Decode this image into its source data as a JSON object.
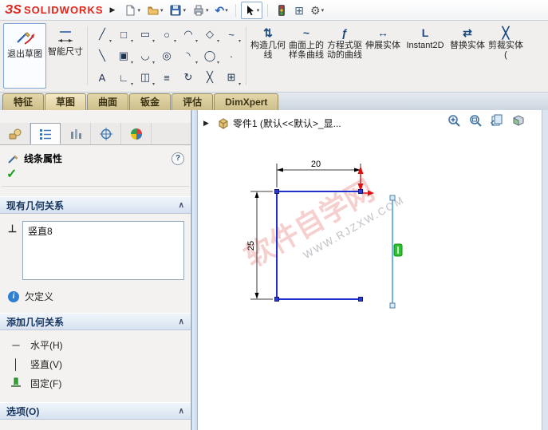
{
  "titlebar": {
    "logo_mark": "ЗS",
    "logo_text": "SOLIDWORKS"
  },
  "ribbon": {
    "exit_sketch_label": "退出草图",
    "smart_dimension_label": "智能尺寸",
    "sketch_tools": [
      {
        "name": "line",
        "glyph": "╱"
      },
      {
        "name": "corner-rectangle",
        "glyph": "□"
      },
      {
        "name": "straight-slot",
        "glyph": "▭"
      },
      {
        "name": "circle",
        "glyph": "○"
      },
      {
        "name": "centerpoint-arc",
        "glyph": "◠"
      },
      {
        "name": "polygon",
        "glyph": "◇"
      },
      {
        "name": "spline",
        "glyph": "~"
      },
      {
        "name": "centerline",
        "glyph": "╲"
      },
      {
        "name": "center-rectangle",
        "glyph": "▣"
      },
      {
        "name": "arc-slot",
        "glyph": "◡"
      },
      {
        "name": "perimeter-circle",
        "glyph": "◎"
      },
      {
        "name": "tangent-arc",
        "glyph": "◝"
      },
      {
        "name": "ellipse",
        "glyph": "◯"
      },
      {
        "name": "point",
        "glyph": "·"
      },
      {
        "name": "text",
        "glyph": "A"
      },
      {
        "name": "sketch-fillet",
        "glyph": "∟"
      },
      {
        "name": "mirror-entities",
        "glyph": "◫"
      },
      {
        "name": "offset-entities",
        "glyph": "≡"
      },
      {
        "name": "convert-entities",
        "glyph": "↻"
      },
      {
        "name": "trim-entities",
        "glyph": "╳"
      },
      {
        "name": "linear-sketch-pattern",
        "glyph": "⊞"
      }
    ],
    "right_tools": [
      {
        "name": "construction-geometry",
        "glyph": "⇅",
        "label": "构造几何线"
      },
      {
        "name": "spline-on-surface",
        "glyph": "~",
        "label": "曲面上的样条曲线"
      },
      {
        "name": "equation-driven-curve",
        "glyph": "ƒ",
        "label": "方程式驱动的曲线"
      },
      {
        "name": "stretch-entities",
        "glyph": "↔",
        "label": "伸展实体"
      },
      {
        "name": "instant2d",
        "glyph": "L",
        "label": "Instant2D"
      },
      {
        "name": "replace-entities",
        "glyph": "⇄",
        "label": "替换实体"
      },
      {
        "name": "trim-entities-cmd",
        "glyph": "╳",
        "label": "剪裁实体("
      }
    ]
  },
  "tabs": [
    {
      "label": "特征"
    },
    {
      "label": "草图"
    },
    {
      "label": "曲面"
    },
    {
      "label": "钣金"
    },
    {
      "label": "评估"
    },
    {
      "label": "DimXpert"
    }
  ],
  "panel": {
    "title": "线条属性",
    "help_glyph": "?",
    "ok_glyph": "✓",
    "existing_relations_header": "现有几何关系",
    "relation_icon_glyph": "⊥",
    "relations": [
      {
        "label": "竖直8"
      }
    ],
    "status": "欠定义",
    "add_relations_header": "添加几何关系",
    "add_relations": [
      {
        "name": "horizontal",
        "glyph": "─",
        "label": "水平(H)"
      },
      {
        "name": "vertical",
        "glyph": "│",
        "label": "竖直(V)"
      },
      {
        "name": "fix",
        "glyph": "",
        "label": "固定(F)"
      }
    ],
    "options_header": "选项(O)"
  },
  "graphics": {
    "feature_tree_item": "零件1 (默认<<默认>_显...",
    "dim_width": "20",
    "dim_height": "25",
    "watermark_line1": "软件自学网",
    "watermark_line2": "WWW.RJZXW.COM"
  }
}
